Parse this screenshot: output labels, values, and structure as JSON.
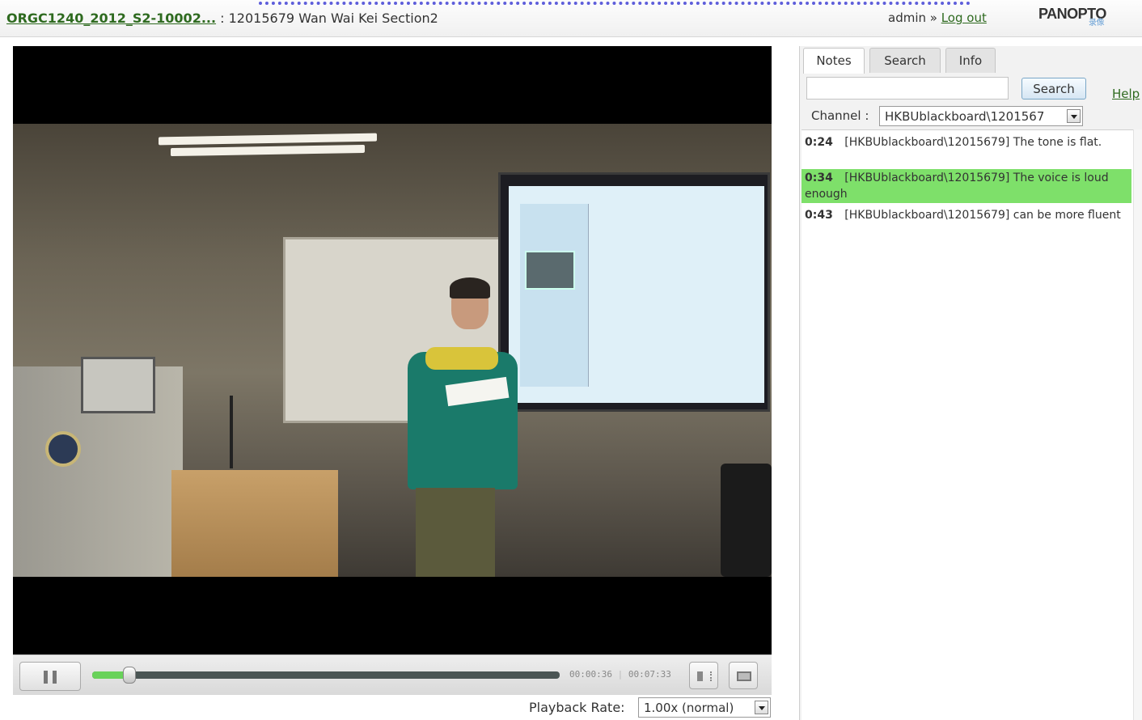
{
  "header": {
    "course_link": "ORGC1240_2012_S2-10002...",
    "separator": " : ",
    "session_title": "12015679 Wan Wai Kei Section2",
    "user": "admin",
    "user_separator": " » ",
    "logout": "Log out",
    "logo": "PANOPTO",
    "logo_sub": "录像"
  },
  "player": {
    "current_time": "00:00:36",
    "time_separator": " | ",
    "total_time": "00:07:33",
    "progress_fraction": 0.08
  },
  "playback": {
    "label": "Playback Rate:",
    "value": "1.00x (normal)"
  },
  "side": {
    "tabs": [
      "Notes",
      "Search",
      "Info"
    ],
    "search_button": "Search",
    "help": "Help",
    "channel_label": "Channel :",
    "channel_value": "HKBUblackboard\\1201567",
    "notes": [
      {
        "time": "0:24",
        "channel": "[HKBUblackboard\\12015679]",
        "text": "The tone is flat."
      },
      {
        "time": "0:34",
        "channel": "[HKBUblackboard\\12015679]",
        "text": "The voice is loud enough"
      },
      {
        "time": "0:43",
        "channel": "[HKBUblackboard\\12015679]",
        "text": "can be more fluent"
      }
    ]
  },
  "colors": {
    "link_green": "#2e6a1f",
    "highlight_green": "#7ee06a",
    "progress_green": "#69d25a"
  }
}
